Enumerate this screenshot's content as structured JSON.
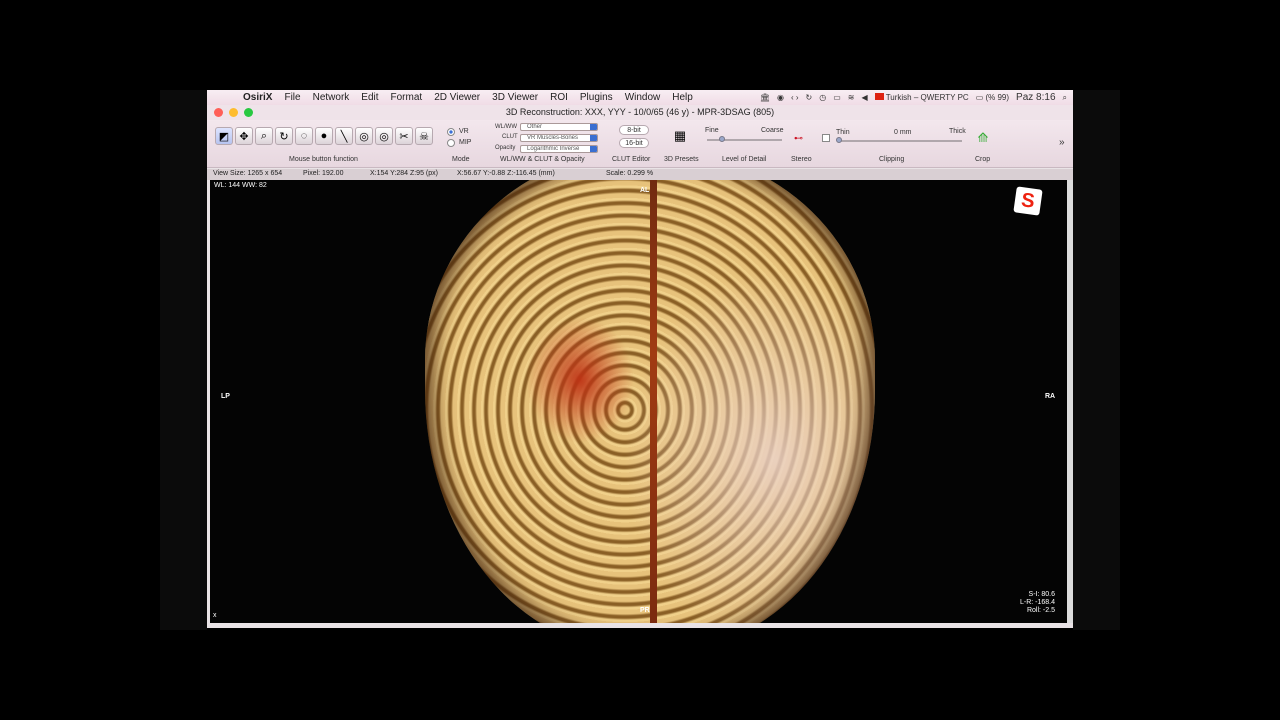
{
  "menubar": {
    "app": "OsiriX",
    "items": [
      "File",
      "Network",
      "Edit",
      "Format",
      "2D Viewer",
      "3D Viewer",
      "ROI",
      "Plugins",
      "Window",
      "Help"
    ],
    "input_source": "Turkish – QWERTY PC",
    "battery": "(% 99)",
    "clock": "Paz 8:16"
  },
  "window": {
    "title": "3D Reconstruction: XXX, YYY - 10/0/65 (46 y) - MPR-3DSAG (805)"
  },
  "toolbar": {
    "groups": {
      "mouse": "Mouse button function",
      "mode": "Mode",
      "wlww": "WL/WW & CLUT & Opacity",
      "clut_editor": "CLUT Editor",
      "presets": "3D Presets",
      "lod": "Level of Detail",
      "stereo": "Stereo",
      "clipping": "Clipping",
      "crop": "Crop"
    },
    "mode_vr": "VR",
    "mode_mip": "MIP",
    "wlww_label": "WL/WW",
    "wlww_value": "Other",
    "clut_label": "CLUT",
    "clut_value": "VR Muscles-Bones",
    "opacity_label": "Opacity",
    "opacity_value": "Logarithmic Inverse",
    "bit8": "8-bit",
    "bit16": "16-bit",
    "lod_fine": "Fine",
    "lod_coarse": "Coarse",
    "clip_thin": "Thin",
    "clip_mm": "0 mm",
    "clip_thick": "Thick"
  },
  "infobar": {
    "view_size": "View Size: 1265 x 654",
    "pixel": "Pixel: 192.00",
    "coords_px": "X:154 Y:284 Z:95 (px)",
    "coords_mm": "X:56.67 Y:-0.88 Z:-116.45 (mm)",
    "scale": "Scale: 0.299 %"
  },
  "viewport": {
    "wl_ww": "WL: 144 WW: 82",
    "orient_top": "AL",
    "orient_bottom": "PR",
    "orient_left": "LP",
    "orient_right": "RA",
    "corner_x": "x",
    "si": "S-I: 80.6",
    "lr": "L-R: -168.4",
    "roll": "Roll: -2.5",
    "logo_letter": "S"
  },
  "colors": {
    "close": "#ff5f57",
    "minimize": "#febc2e",
    "zoom": "#28c840",
    "accent": "#3b6fd6"
  }
}
